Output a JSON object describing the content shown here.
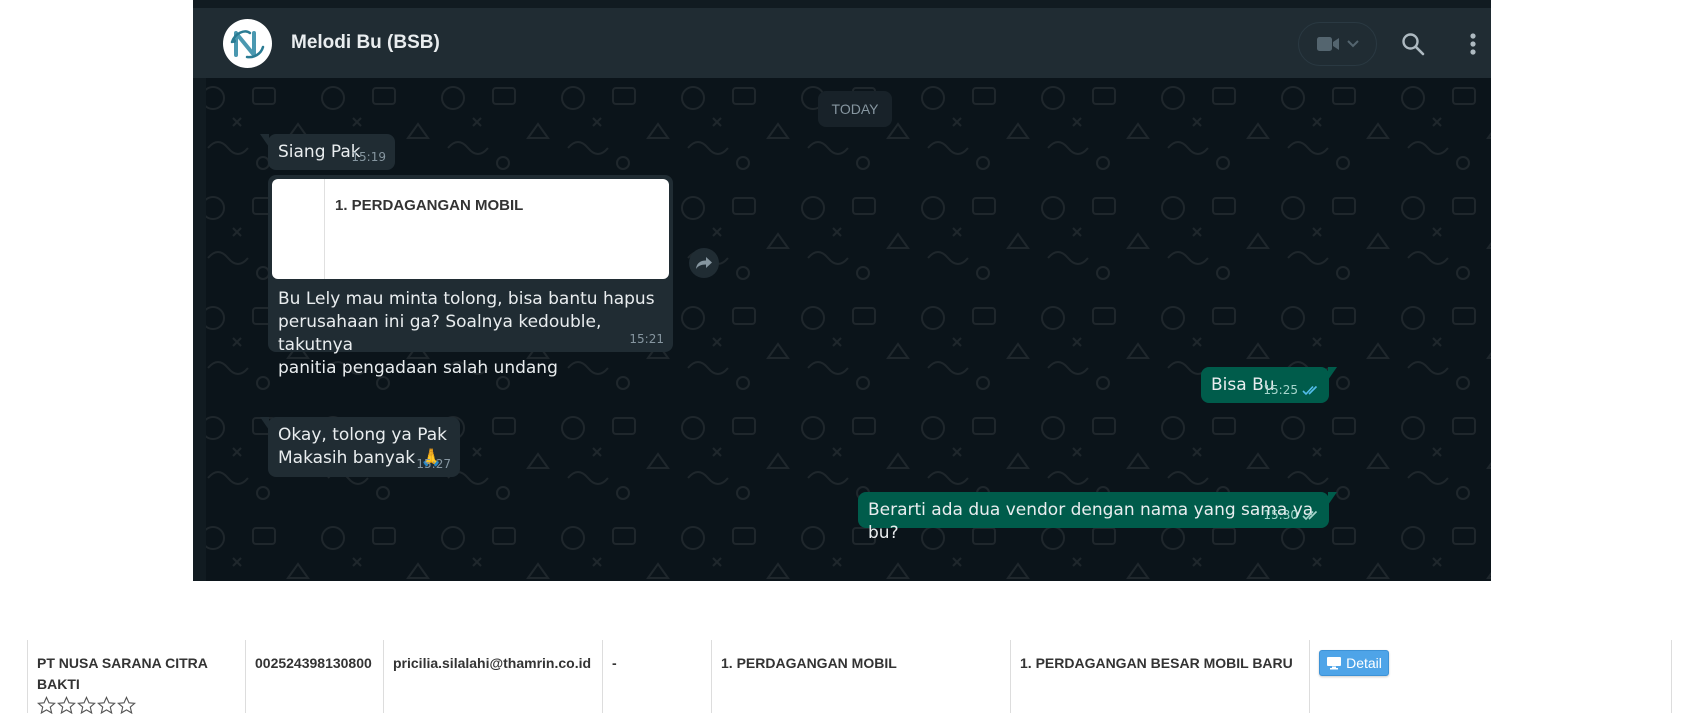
{
  "chat": {
    "contact_name": "Melodi Bu (BSB)",
    "date_chip": "TODAY",
    "icons": {
      "video": "video-camera-icon",
      "dropdown": "chevron-down-icon",
      "search": "search-icon",
      "menu": "kebab-menu-icon",
      "forward": "forward-icon",
      "read": "double-check-icon"
    },
    "messages": [
      {
        "direction": "in",
        "text": "Siang Pak",
        "time": "15:19"
      },
      {
        "direction": "in",
        "preview_text": "1. PERDAGANGAN MOBIL",
        "lines": [
          "Bu Lely mau minta tolong, bisa bantu hapus",
          "perusahaan ini ga? Soalnya kedouble, takutnya",
          "panitia pengadaan salah undang"
        ],
        "time": "15:21"
      },
      {
        "direction": "out",
        "text": "Bisa Bu",
        "time": "15:25",
        "status": "read"
      },
      {
        "direction": "in",
        "lines": [
          "Okay, tolong ya Pak",
          "Makasih banyak 🙏"
        ],
        "time": "15:27"
      },
      {
        "direction": "out",
        "text": "Berarti ada dua vendor dengan nama yang sama ya bu?",
        "time": "15:30",
        "status": "delivered"
      }
    ],
    "colors": {
      "background": "#0b141a",
      "header": "#202c33",
      "incoming": "#202c33",
      "outgoing": "#005c4b",
      "text": "#e9edef",
      "meta": "#8696a0",
      "read_tick": "#53bdeb"
    }
  },
  "vendor_row": {
    "company": [
      "PT NUSA SARANA CITRA",
      "BAKTI"
    ],
    "rating_stars": 0,
    "rating_max": 5,
    "npwp": "002524398130800",
    "email": "pricilia.silalahi@thamrin.co.id",
    "dash": "-",
    "business_field": "1. PERDAGANGAN MOBIL",
    "sub_field": "1. PERDAGANGAN BESAR MOBIL BARU",
    "detail_label": "Detail",
    "detail_icon": "monitor-icon"
  }
}
